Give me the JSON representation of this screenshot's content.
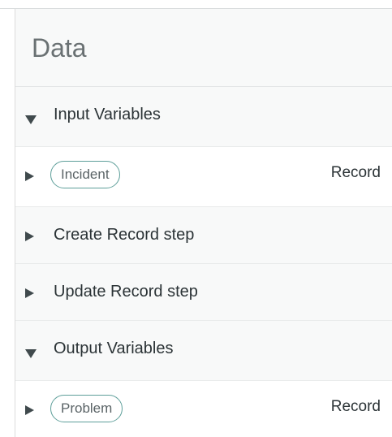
{
  "panel": {
    "title": "Data"
  },
  "sections": {
    "input": {
      "label": "Input Variables",
      "variables": [
        {
          "name": "Incident",
          "type": "Record"
        }
      ]
    },
    "steps": [
      {
        "label": "Create Record step"
      },
      {
        "label": "Update Record step"
      }
    ],
    "output": {
      "label": "Output Variables",
      "variables": [
        {
          "name": "Problem",
          "type": "Record"
        }
      ]
    }
  },
  "icons": {
    "expanded": "caret-down-icon",
    "collapsed": "caret-right-icon"
  },
  "colors": {
    "pill_border": "#5e9f9a",
    "header_bg": "#f8f9f9",
    "text": "#2b3336"
  }
}
